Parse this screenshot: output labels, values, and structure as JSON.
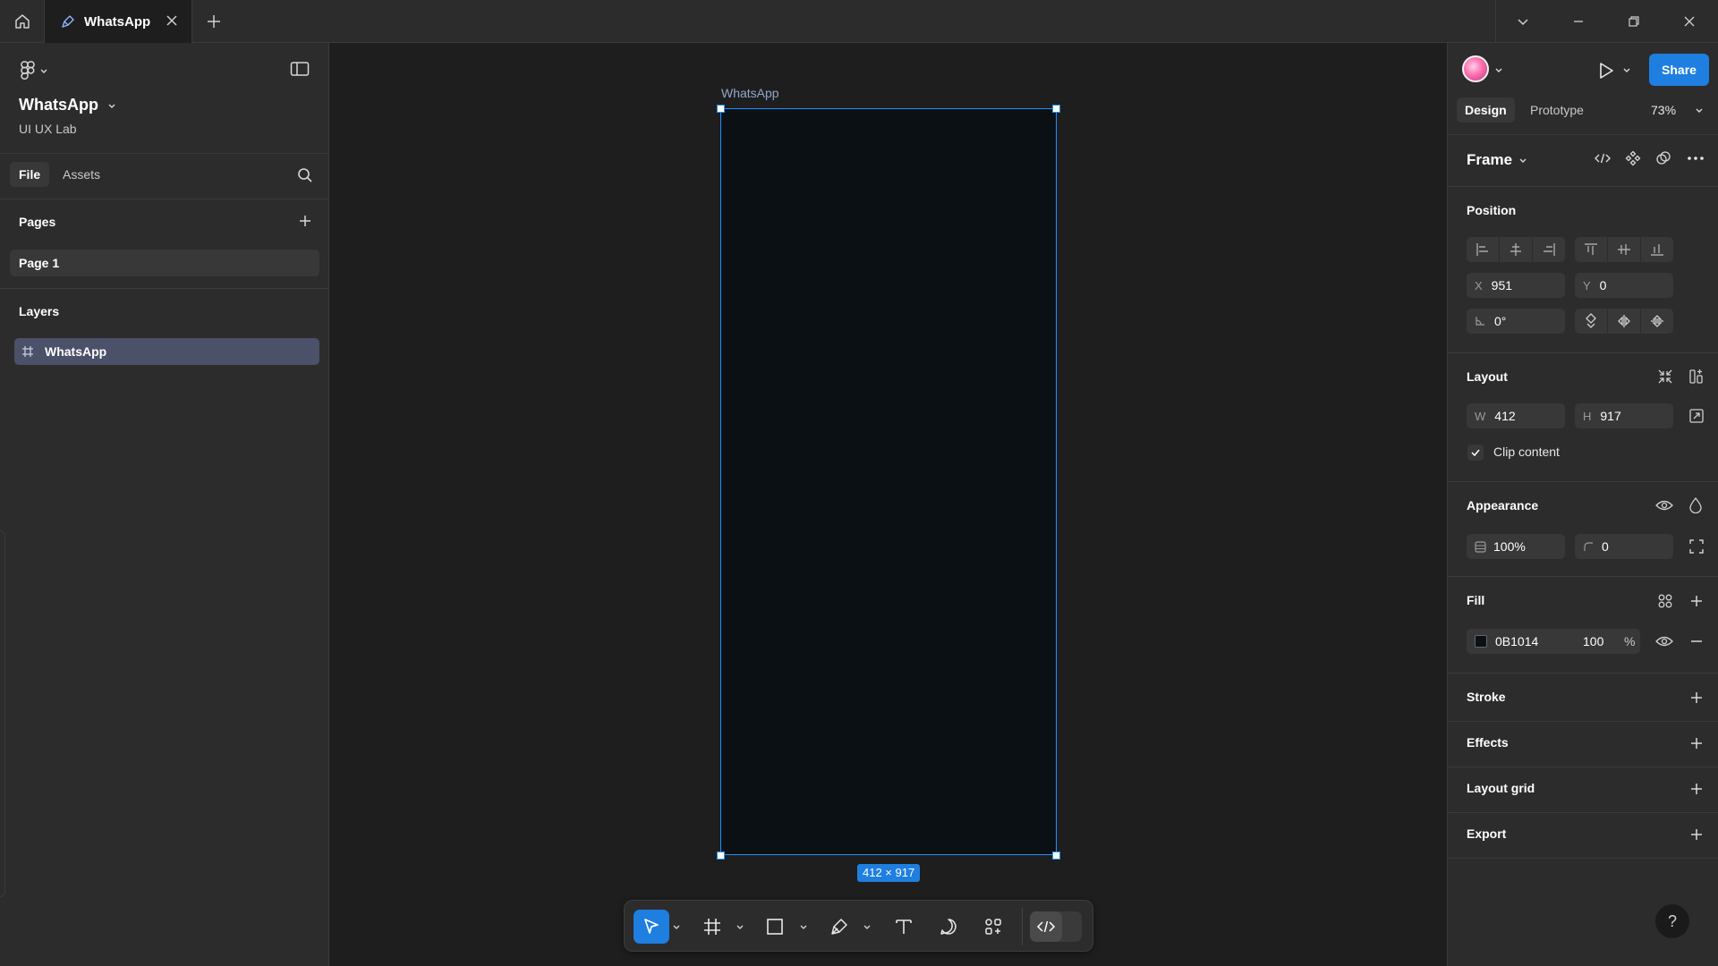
{
  "titlebar": {
    "tab_title": "WhatsApp"
  },
  "left_panel": {
    "file_name": "WhatsApp",
    "team_name": "UI UX Lab",
    "tabs": [
      "File",
      "Assets"
    ],
    "pages_heading": "Pages",
    "pages": [
      "Page 1"
    ],
    "layers_heading": "Layers",
    "layers": [
      "WhatsApp"
    ]
  },
  "canvas": {
    "frame_name": "WhatsApp",
    "frame_size_label": "412 × 917",
    "frame_fill_color": "#0B1014",
    "selection_color": "#1E90FF"
  },
  "right_panel": {
    "share_label": "Share",
    "tabs": [
      "Design",
      "Prototype"
    ],
    "zoom": "73%",
    "selection_type": "Frame",
    "position": {
      "heading": "Position",
      "x_label": "X",
      "x_value": "951",
      "y_label": "Y",
      "y_value": "0",
      "rotation": "0°"
    },
    "layout": {
      "heading": "Layout",
      "w_label": "W",
      "w_value": "412",
      "h_label": "H",
      "h_value": "917",
      "clip_content_label": "Clip content",
      "clip_content_checked": true
    },
    "appearance": {
      "heading": "Appearance",
      "opacity": "100%",
      "corner_radius": "0"
    },
    "fill": {
      "heading": "Fill",
      "hex": "0B1014",
      "opacity": "100",
      "percent_sign": "%"
    },
    "sections": [
      "Stroke",
      "Effects",
      "Layout grid",
      "Export"
    ],
    "help_label": "?"
  },
  "colors": {
    "accent": "#1E7FE0",
    "panel_bg": "#2C2C2C",
    "canvas_bg": "#1E1E1E",
    "layer_selected": "#4A5169"
  }
}
